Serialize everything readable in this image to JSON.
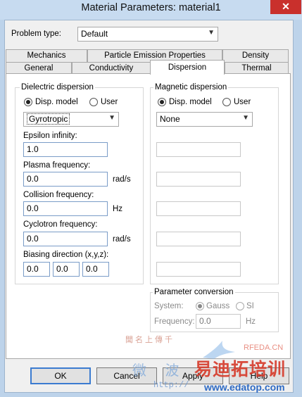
{
  "window": {
    "title": "Material Parameters: material1",
    "close_glyph": "✕"
  },
  "problem_type": {
    "label": "Problem type:",
    "value": "Default"
  },
  "tabs_row_top": [
    "Mechanics",
    "Particle Emission Properties",
    "Density"
  ],
  "tabs_row_bottom": [
    "General",
    "Conductivity",
    "Dispersion",
    "Thermal"
  ],
  "active_tab": "Dispersion",
  "dielectric": {
    "title": "Dielectric dispersion",
    "radio_model": "Disp. model",
    "radio_user": "User",
    "model_value": "Gyrotropic",
    "epsilon_label": "Epsilon infinity:",
    "epsilon_value": "1.0",
    "plasma_label": "Plasma frequency:",
    "plasma_value": "0.0",
    "plasma_unit": "rad/s",
    "collision_label": "Collision frequency:",
    "collision_value": "0.0",
    "collision_unit": "Hz",
    "cyclotron_label": "Cyclotron frequency:",
    "cyclotron_value": "0.0",
    "cyclotron_unit": "rad/s",
    "biasing_label": "Biasing direction (x,y,z):",
    "bias_x": "0.0",
    "bias_y": "0.0",
    "bias_z": "0.0"
  },
  "magnetic": {
    "title": "Magnetic dispersion",
    "radio_model": "Disp. model",
    "radio_user": "User",
    "model_value": "None"
  },
  "conversion": {
    "title": "Parameter conversion",
    "system_label": "System:",
    "gauss": "Gauss",
    "si": "SI",
    "frequency_label": "Frequency:",
    "frequency_value": "0.0",
    "frequency_unit": "Hz"
  },
  "buttons": {
    "ok": "OK",
    "cancel": "Cancel",
    "apply": "Apply",
    "help": "Help"
  },
  "watermark": {
    "line1": "聞名上傳千",
    "brand": "RFEDA.CN",
    "line2": "微 波",
    "site_cn": "易迪拓培训",
    "url_left": "http://",
    "url_right": "www.edatop.com"
  },
  "colors": {
    "accent": "#3b7bd0",
    "close": "#c9302c",
    "watermark_red": "#d63a2a",
    "watermark_blue": "#2f6bc4"
  }
}
